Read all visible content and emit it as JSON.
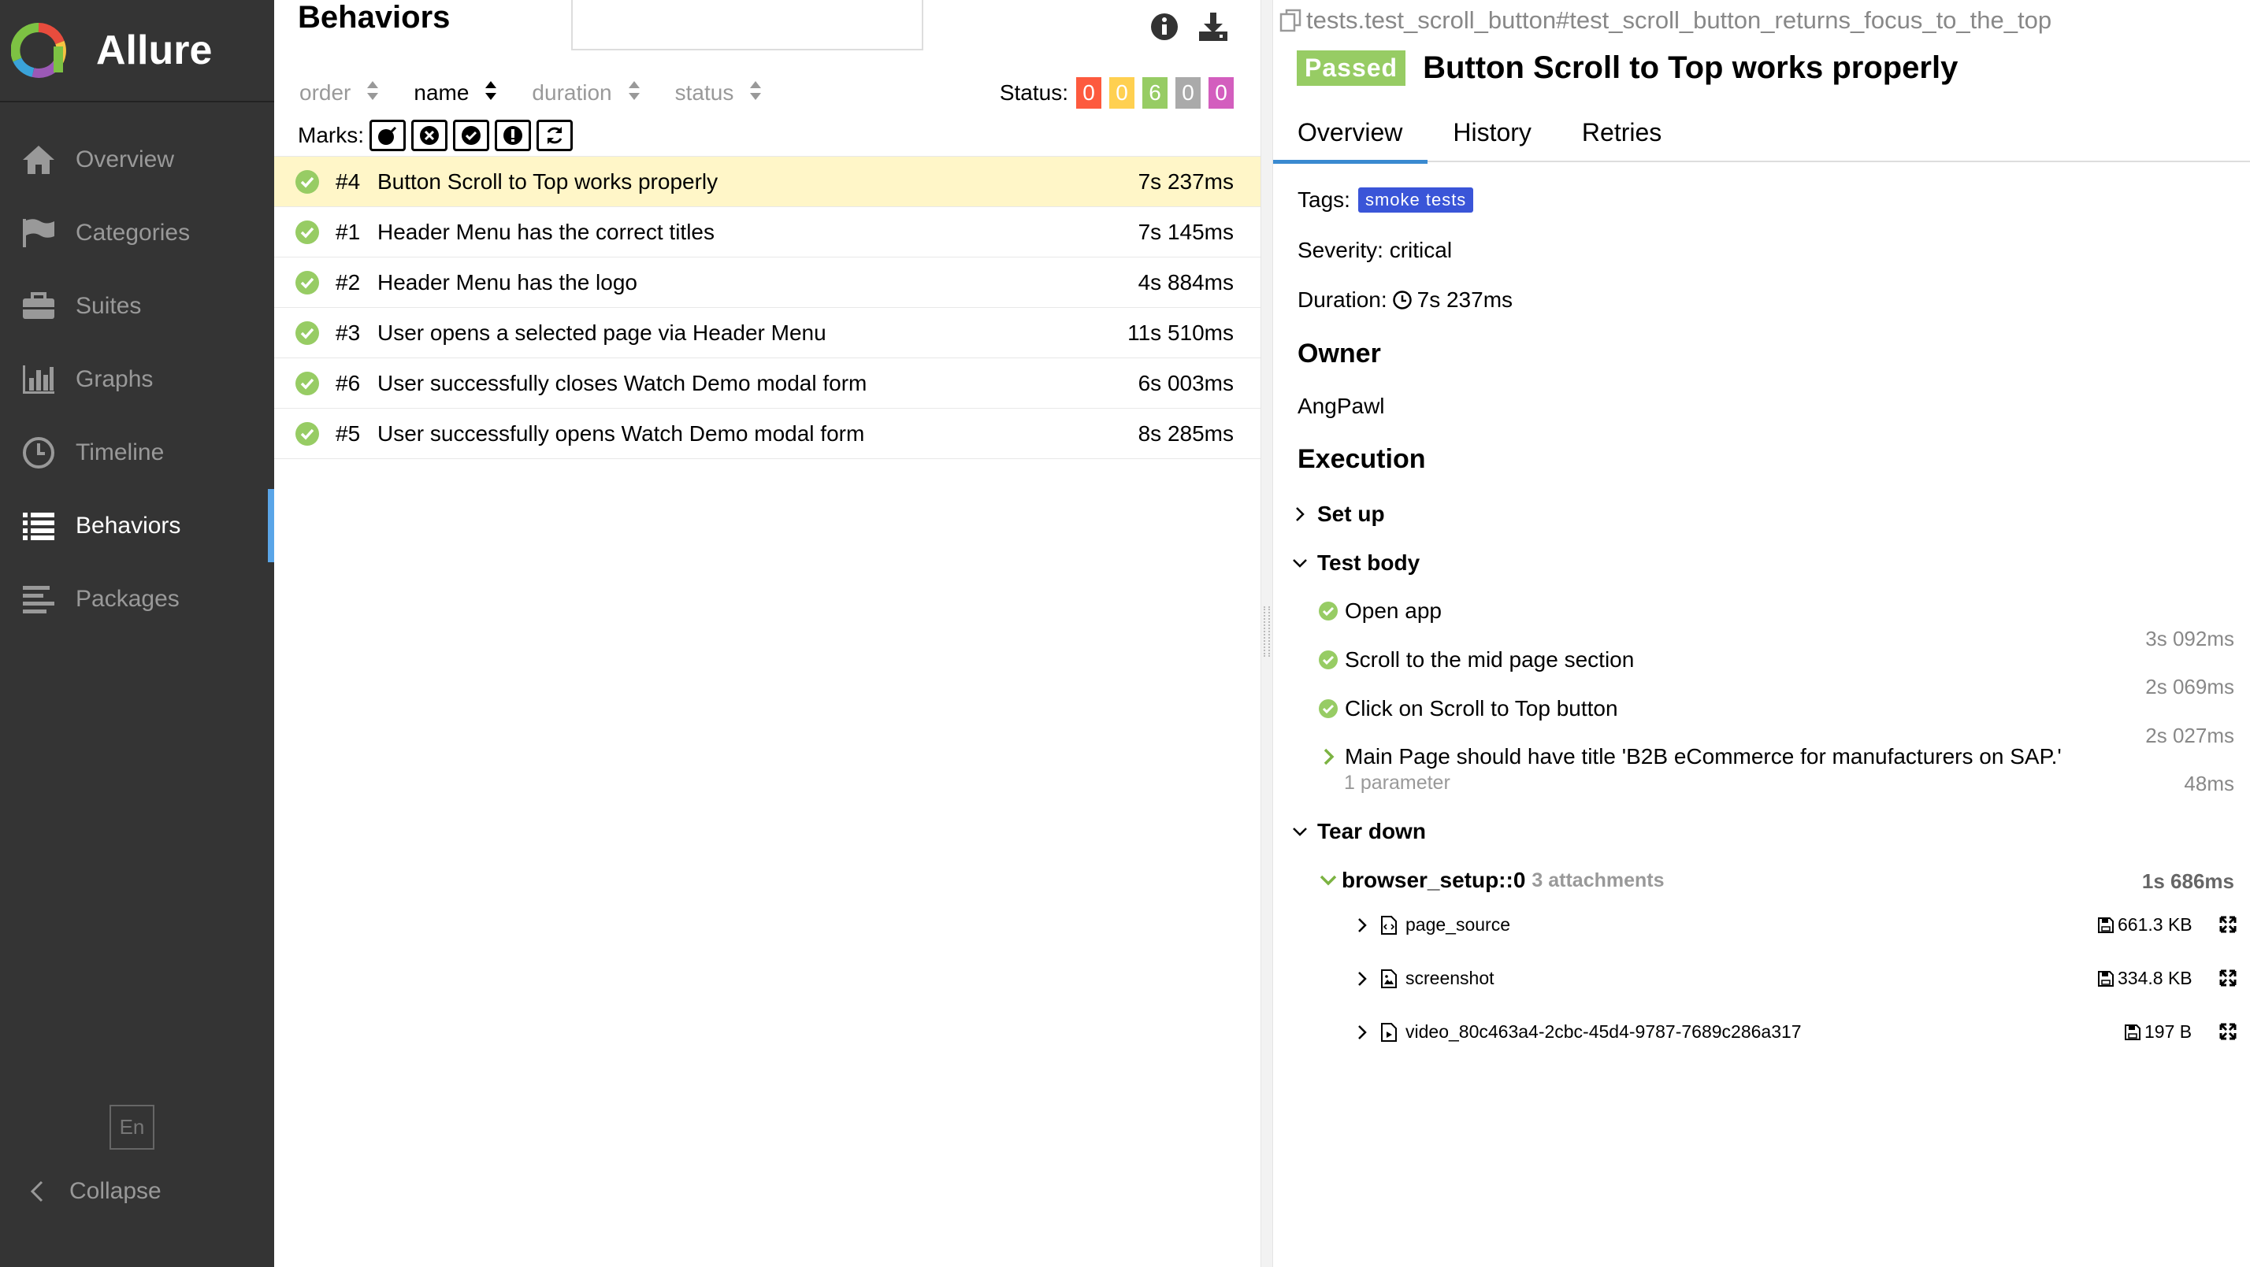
{
  "sidebar": {
    "brand": "Allure",
    "items": [
      {
        "label": "Overview"
      },
      {
        "label": "Categories"
      },
      {
        "label": "Suites"
      },
      {
        "label": "Graphs"
      },
      {
        "label": "Timeline"
      },
      {
        "label": "Behaviors"
      },
      {
        "label": "Packages"
      }
    ],
    "active_item": "Behaviors",
    "language": "En",
    "collapse": "Collapse"
  },
  "list": {
    "title": "Behaviors",
    "search_value": "",
    "sort": [
      {
        "label": "order"
      },
      {
        "label": "name"
      },
      {
        "label": "duration"
      },
      {
        "label": "status"
      }
    ],
    "active_sort": "name",
    "status_label": "Status:",
    "status_counts": [
      {
        "value": "0",
        "color": "#fd5a3e"
      },
      {
        "value": "0",
        "color": "#ffd050"
      },
      {
        "value": "6",
        "color": "#97cc64"
      },
      {
        "value": "0",
        "color": "#aaaaaa"
      },
      {
        "value": "0",
        "color": "#d35ebe"
      }
    ],
    "marks_label": "Marks:",
    "rows": [
      {
        "num": "#4",
        "name": "Button Scroll to Top works properly",
        "duration": "7s 237ms",
        "selected": true
      },
      {
        "num": "#1",
        "name": "Header Menu has the correct titles",
        "duration": "7s 145ms"
      },
      {
        "num": "#2",
        "name": "Header Menu has the logo",
        "duration": "4s 884ms"
      },
      {
        "num": "#3",
        "name": "User opens a selected page via Header Menu",
        "duration": "11s 510ms"
      },
      {
        "num": "#6",
        "name": "User successfully closes Watch Demo modal form",
        "duration": "6s 003ms"
      },
      {
        "num": "#5",
        "name": "User successfully opens Watch Demo modal form",
        "duration": "8s 285ms"
      }
    ]
  },
  "detail": {
    "full_name": "tests.test_scroll_button#test_scroll_button_returns_focus_to_the_top",
    "status_badge": "Passed",
    "title": "Button Scroll to Top works properly",
    "tabs": [
      {
        "label": "Overview"
      },
      {
        "label": "History"
      },
      {
        "label": "Retries"
      }
    ],
    "active_tab": "Overview",
    "tags_label": "Tags:",
    "tag": "smoke tests",
    "severity": "Severity: critical",
    "duration_label": "Duration:",
    "duration": "7s 237ms",
    "owner_heading": "Owner",
    "owner": "AngPawl",
    "execution_heading": "Execution",
    "setup_label": "Set up",
    "test_body_label": "Test body",
    "steps": [
      {
        "name": "Open app",
        "duration": "3s 092ms"
      },
      {
        "name": "Scroll to the mid page section",
        "duration": "2s 069ms"
      },
      {
        "name": "Click on Scroll to Top button",
        "duration": "2s 027ms"
      },
      {
        "name": "Main Page should have title 'B2B eCommerce for manufacturers on SAP.'",
        "duration": "48ms",
        "params": "1 parameter"
      }
    ],
    "teardown_label": "Tear down",
    "fixture": {
      "name": "browser_setup::0",
      "attachments_count": "3 attachments",
      "duration": "1s 686ms"
    },
    "attachments": [
      {
        "name": "page_source",
        "size": "661.3 KB"
      },
      {
        "name": "screenshot",
        "size": "334.8 KB"
      },
      {
        "name": "video_80c463a4-2cbc-45d4-9787-7689c286a317",
        "size": "197 B"
      }
    ]
  }
}
